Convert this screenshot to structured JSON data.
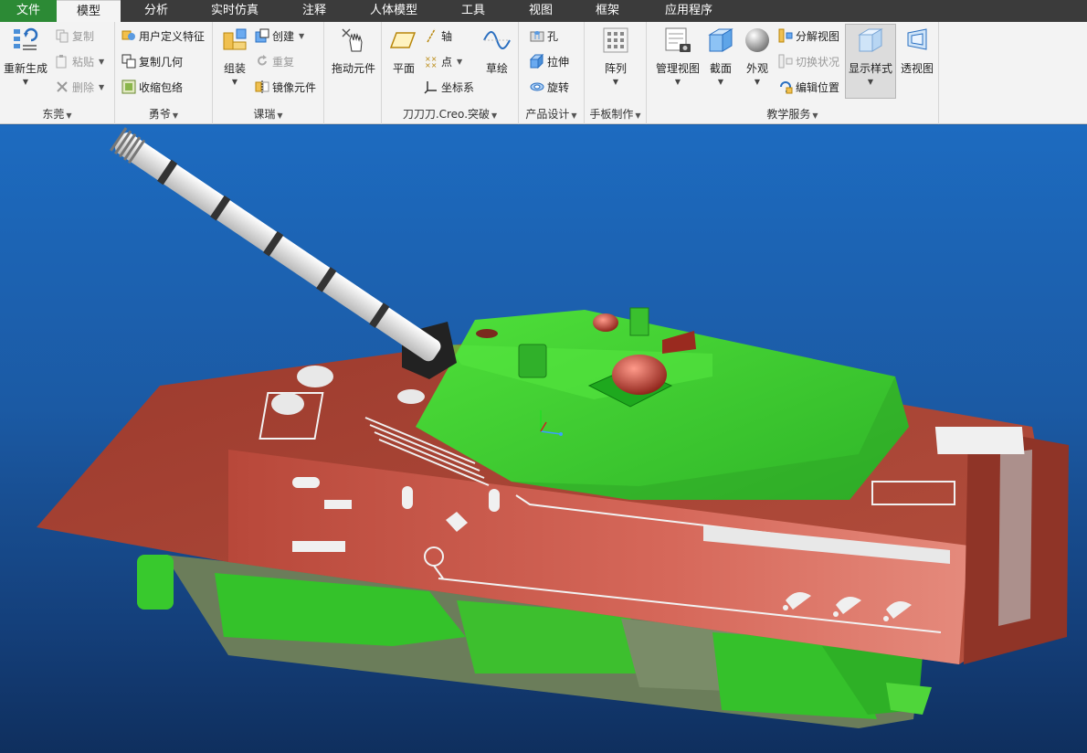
{
  "menu": {
    "file": "文件",
    "model": "模型",
    "analysis": "分析",
    "simulation": "实时仿真",
    "annotation": "注释",
    "human_model": "人体模型",
    "tools": "工具",
    "view": "视图",
    "framework": "框架",
    "applications": "应用程序"
  },
  "groups": {
    "g1": {
      "label": "东莞",
      "regenerate": "重新生成",
      "copy": "复制",
      "paste": "粘贴",
      "delete": "删除"
    },
    "g2": {
      "label": "勇爷",
      "user_feature": "用户定义特征",
      "copy_geometry": "复制几何",
      "shrinkwrap": "收缩包络"
    },
    "g3": {
      "label": "课瑞",
      "assemble": "组装",
      "create": "创建",
      "repeat": "重复",
      "mirror": "镜像元件"
    },
    "g4": {
      "drag": "拖动元件"
    },
    "g5": {
      "label": "刀刀刀.Creo.突破",
      "plane": "平面",
      "axis": "轴",
      "point": "点",
      "csys": "坐标系",
      "sketch": "草绘"
    },
    "g6": {
      "label": "产品设计",
      "hole": "孔",
      "extrude": "拉伸",
      "revolve": "旋转"
    },
    "g7": {
      "label": "手板制作",
      "pattern": "阵列"
    },
    "g8": {
      "label": "教学服务",
      "manage_views": "管理视图",
      "section": "截面",
      "appearance": "外观",
      "explode": "分解视图",
      "toggle_state": "切换状况",
      "edit_position": "编辑位置",
      "display_style": "显示样式",
      "perspective": "透视图"
    }
  },
  "colors": {
    "file_tab": "#2c8a35",
    "menubar": "#3b3b3b",
    "hull": "#a53f2f",
    "turret": "#3fcf2f",
    "viewport_top": "#1d6bc0"
  }
}
